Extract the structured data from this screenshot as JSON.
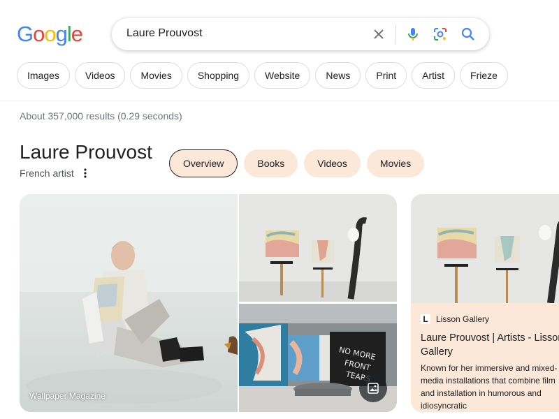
{
  "logo": {
    "text": "Google"
  },
  "search": {
    "query": "Laure Prouvost"
  },
  "icons": {
    "clear": "close-icon",
    "mic": "microphone-icon",
    "lens": "lens-icon",
    "search": "search-icon"
  },
  "tabs": [
    "Images",
    "Videos",
    "Movies",
    "Shopping",
    "Website",
    "News",
    "Print",
    "Artist",
    "Frieze"
  ],
  "results_count": "About 357,000 results (0.29 seconds)",
  "knowledge_panel": {
    "title": "Laure Prouvost",
    "subtitle": "French artist",
    "tabs": [
      "Overview",
      "Books",
      "Videos",
      "Movies"
    ],
    "active_tab": "Overview",
    "images": {
      "main_caption": "Wallpaper Magazine"
    },
    "card": {
      "source": "Lisson Gallery",
      "favicon_letter": "L",
      "title": "Laure Prouvost | Artists - Lisson Gallery",
      "description": "Known for her immersive and mixed-media installations that combine film and installation in humorous and idiosyncratic"
    }
  },
  "colors": {
    "chip_accent": "#fce8d9",
    "google_blue": "#4285f4",
    "google_red": "#ea4335",
    "google_yellow": "#fbbc05",
    "google_green": "#34a853"
  }
}
